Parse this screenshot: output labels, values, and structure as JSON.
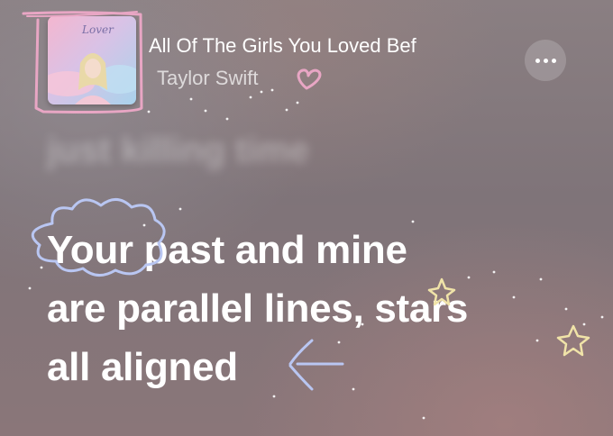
{
  "now_playing": {
    "title": "All Of The Girls You Loved Bef",
    "artist": "Taylor Swift",
    "album_art_text": "Lover"
  },
  "lyrics": {
    "previous": "just killing time",
    "current": [
      "Your past and mine",
      "are parallel lines, stars",
      "all aligned"
    ]
  },
  "icons": {
    "more": "more-ellipsis-icon"
  },
  "colors": {
    "lyric_active": "#ffffff",
    "doodle_pink": "#e8a6c4",
    "doodle_blue": "#b9c6f2",
    "doodle_yellow": "#f0e3a8"
  }
}
